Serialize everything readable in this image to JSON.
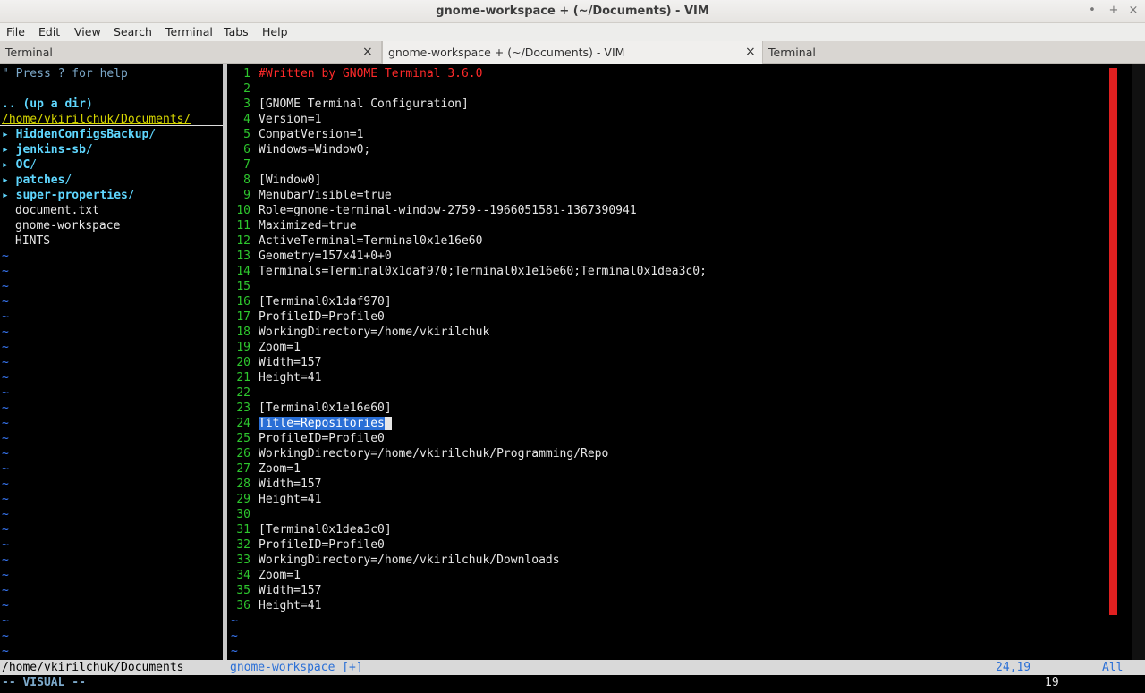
{
  "window": {
    "title": "gnome-workspace + (~/Documents) - VIM",
    "controls": {
      "minimize": "•",
      "maximize": "+",
      "close": "×"
    }
  },
  "menu": [
    "File",
    "Edit",
    "View",
    "Search",
    "Terminal",
    "Tabs",
    "Help"
  ],
  "tabs": [
    {
      "label": "Terminal",
      "close": "×"
    },
    {
      "label": "gnome-workspace + (~/Documents) - VIM",
      "close": "×"
    },
    {
      "label": "Terminal"
    }
  ],
  "tree": {
    "help": "\" Press ? for help",
    "updir": ".. (up a dir)",
    "cwd": "/home/vkirilchuk/Documents/",
    "arrow": "▸",
    "dirs": [
      "HiddenConfigsBackup",
      "jenkins-sb",
      "OC",
      "patches",
      "super-properties"
    ],
    "files": [
      "document.txt",
      "gnome-workspace",
      "HINTS"
    ],
    "tilde": "~"
  },
  "editor": {
    "lines": [
      "#Written by GNOME Terminal 3.6.0",
      "",
      "[GNOME Terminal Configuration]",
      "Version=1",
      "CompatVersion=1",
      "Windows=Window0;",
      "",
      "[Window0]",
      "MenubarVisible=true",
      "Role=gnome-terminal-window-2759--1966051581-1367390941",
      "Maximized=true",
      "ActiveTerminal=Terminal0x1e16e60",
      "Geometry=157x41+0+0",
      "Terminals=Terminal0x1daf970;Terminal0x1e16e60;Terminal0x1dea3c0;",
      "",
      "[Terminal0x1daf970]",
      "ProfileID=Profile0",
      "WorkingDirectory=/home/vkirilchuk",
      "Zoom=1",
      "Width=157",
      "Height=41",
      "",
      "[Terminal0x1e16e60]",
      "Title=Repositories",
      "ProfileID=Profile0",
      "WorkingDirectory=/home/vkirilchuk/Programming/Repo",
      "Zoom=1",
      "Width=157",
      "Height=41",
      "",
      "[Terminal0x1dea3c0]",
      "ProfileID=Profile0",
      "WorkingDirectory=/home/vkirilchuk/Downloads",
      "Zoom=1",
      "Width=157",
      "Height=41"
    ],
    "selected_line": 24,
    "tilde": "~"
  },
  "status": {
    "tree_path": "/home/vkirilchuk/Documents",
    "filename": "gnome-workspace [+]",
    "position": "24,19",
    "scroll": "All"
  },
  "cmdline": {
    "mode": "-- VISUAL --",
    "count": "19"
  },
  "colors": {
    "line_numbers": "#2ec72e",
    "comment": "#ff2a2a",
    "directory": "#5fd7ff",
    "selection": "#2a6fd6",
    "tilde": "#3a7cff"
  }
}
